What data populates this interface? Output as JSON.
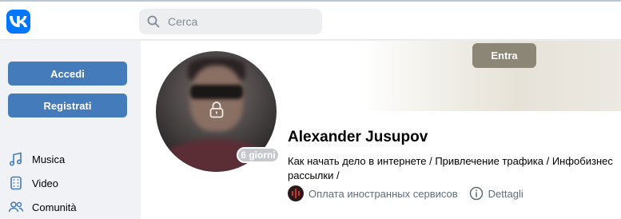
{
  "header": {
    "logo_icon": "vk-logo-icon",
    "search": {
      "placeholder": "Cerca",
      "icon": "search-icon"
    }
  },
  "sidebar": {
    "login_label": "Accedi",
    "register_label": "Registrati",
    "items": [
      {
        "label": "Musica",
        "icon": "music-icon"
      },
      {
        "label": "Video",
        "icon": "video-icon"
      },
      {
        "label": "Comunità",
        "icon": "community-icon"
      }
    ]
  },
  "profile": {
    "enter_label": "Entra",
    "name": "Alexander Jusupov",
    "status": "Как начать дело в интернете / Привлечение трафика / Инфобизнес рассылки /",
    "online_badge": "6 giorni",
    "community_link": "Оплата иностранных сервисов",
    "details_label": "Dettagli"
  },
  "colors": {
    "brand": "#0077ff",
    "button_blue": "#447bba",
    "cover_button": "#8c8677",
    "page_bg": "#ebedf0"
  }
}
